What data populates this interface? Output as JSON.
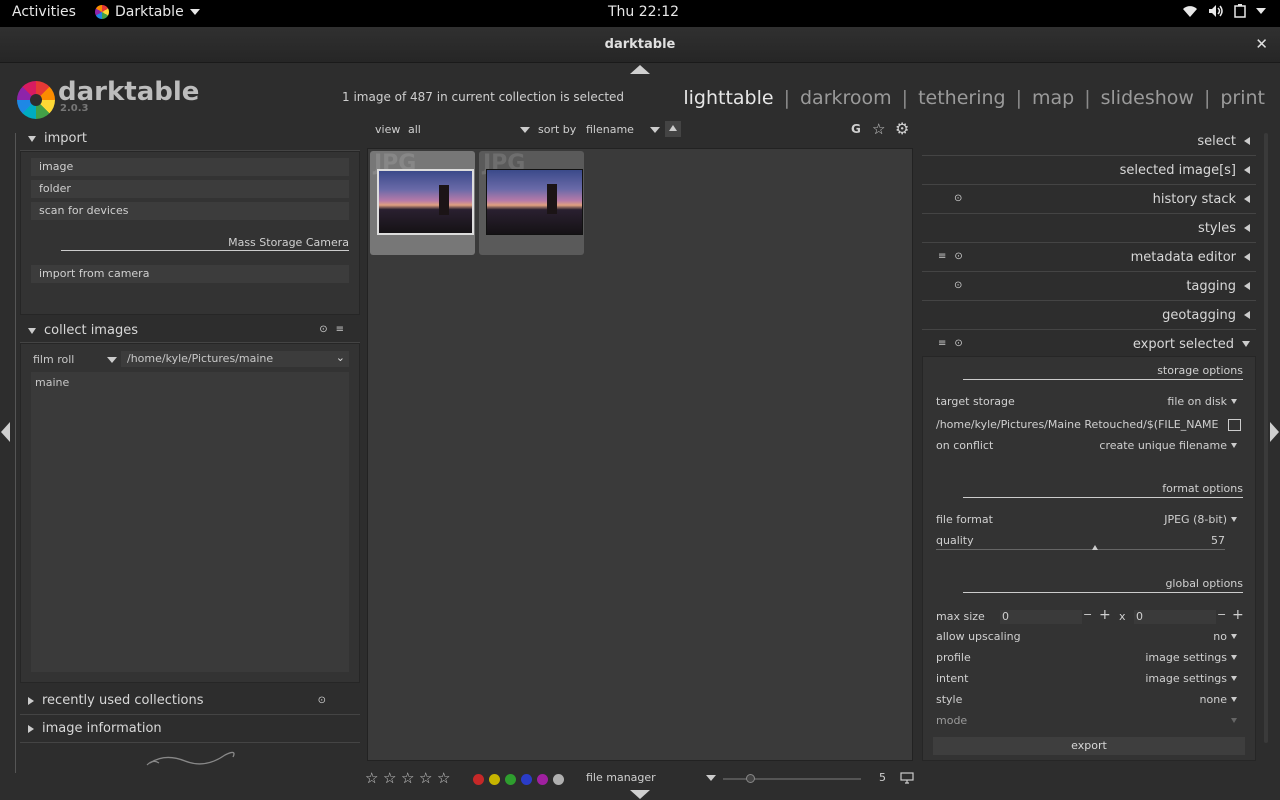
{
  "topbar": {
    "activities": "Activities",
    "app_menu": "Darktable",
    "clock": "Thu 22:12"
  },
  "window": {
    "title": "darktable",
    "close_glyph": "✕"
  },
  "header": {
    "app_name": "darktable",
    "version": "2.0.3",
    "selection_info": "1 image of 487 in current collection is selected",
    "views": [
      "lighttable",
      "darkroom",
      "tethering",
      "map",
      "slideshow",
      "print"
    ],
    "active_view": "lighttable"
  },
  "left": {
    "import": {
      "title": "import",
      "buttons": [
        "image",
        "folder",
        "scan for devices"
      ],
      "device_label": "Mass Storage Camera",
      "import_from_camera": "import from camera"
    },
    "collect": {
      "title": "collect images",
      "property": "film roll",
      "path": "/home/kyle/Pictures/maine",
      "items": [
        "maine"
      ]
    },
    "recent": {
      "title": "recently used collections"
    },
    "info": {
      "title": "image information"
    }
  },
  "filter": {
    "view_label": "view",
    "view_value": "all",
    "sort_label": "sort by",
    "sort_value": "filename",
    "grouping": "G"
  },
  "thumbnails": [
    {
      "type": "JPG",
      "selected": true
    },
    {
      "type": "JPG",
      "selected": false
    }
  ],
  "bottom": {
    "stars": 5,
    "color_labels": [
      "#c62828",
      "#c6b400",
      "#2e9e2e",
      "#2a3cc8",
      "#a020a0",
      "#b0b0b0"
    ],
    "layout": "file manager",
    "zoom": "5"
  },
  "right": {
    "sections": [
      "select",
      "selected image[s]",
      "history stack",
      "styles",
      "metadata editor",
      "tagging",
      "geotagging",
      "export selected"
    ],
    "export": {
      "storage_options": "storage options",
      "target_storage_label": "target storage",
      "target_storage_value": "file on disk",
      "path": "/home/kyle/Pictures/Maine Retouched/$(FILE_NAME)",
      "on_conflict_label": "on conflict",
      "on_conflict_value": "create unique filename",
      "format_options": "format options",
      "file_format_label": "file format",
      "file_format_value": "JPEG (8-bit)",
      "quality_label": "quality",
      "quality_value": "57",
      "global_options": "global options",
      "max_size_label": "max size",
      "max_w": "0",
      "x_label": "x",
      "max_h": "0",
      "upscaling_label": "allow upscaling",
      "upscaling_value": "no",
      "profile_label": "profile",
      "profile_value": "image settings",
      "intent_label": "intent",
      "intent_value": "image settings",
      "style_label": "style",
      "style_value": "none",
      "mode_label": "mode",
      "export_button": "export"
    }
  }
}
